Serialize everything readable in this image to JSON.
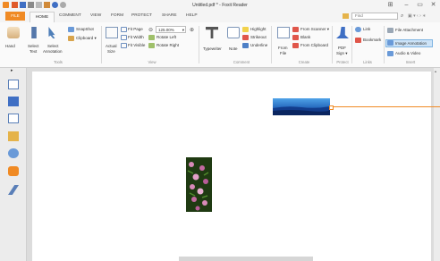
{
  "window": {
    "title": "Untitled.pdf * - Foxit Reader"
  },
  "tabs": {
    "file": "FILE",
    "home": "HOME",
    "comment": "COMMENT",
    "view": "VIEW",
    "form": "FORM",
    "protect": "PROTECT",
    "share": "SHARE",
    "help": "HELP"
  },
  "search": {
    "placeholder": "Find"
  },
  "ribbon": {
    "tools": {
      "hand": "Hand",
      "select_text_1": "Select",
      "select_text_2": "Text",
      "select_annot_1": "Select",
      "select_annot_2": "Annotation",
      "snapshot": "SnapShot",
      "clipboard": "Clipboard ▾",
      "group": "Tools"
    },
    "view": {
      "actual_size_1": "Actual",
      "actual_size_2": "Size",
      "fit_page": "Fit Page",
      "fit_width": "Fit Width",
      "fit_visible": "Fit Visible",
      "zoom": "125.00%",
      "rotate_left": "Rotate Left",
      "rotate_right": "Rotate Right",
      "group": "View"
    },
    "comment": {
      "typewriter": "Typewriter",
      "note": "Note",
      "highlight": "Highlight",
      "strikeout": "Strikeout",
      "underline": "Underline",
      "group": "Comment"
    },
    "create": {
      "from_file_1": "From",
      "from_file_2": "File",
      "from_scanner": "From Scanner ▾",
      "blank": "Blank",
      "from_clipboard": "From Clipboard",
      "group": "Create"
    },
    "protect": {
      "pdf_sign_1": "PDF",
      "pdf_sign_2": "Sign ▾",
      "group": "Protect"
    },
    "links": {
      "link": "Link",
      "bookmark": "Bookmark",
      "group": "Links"
    },
    "insert": {
      "file_attachment": "File Attachment",
      "image_annotation": "Image Annotation",
      "audio_video": "Audio & Video",
      "group": "Insert"
    }
  },
  "colors": {
    "accent": "#f08a24",
    "selected": "#cde3f7"
  }
}
